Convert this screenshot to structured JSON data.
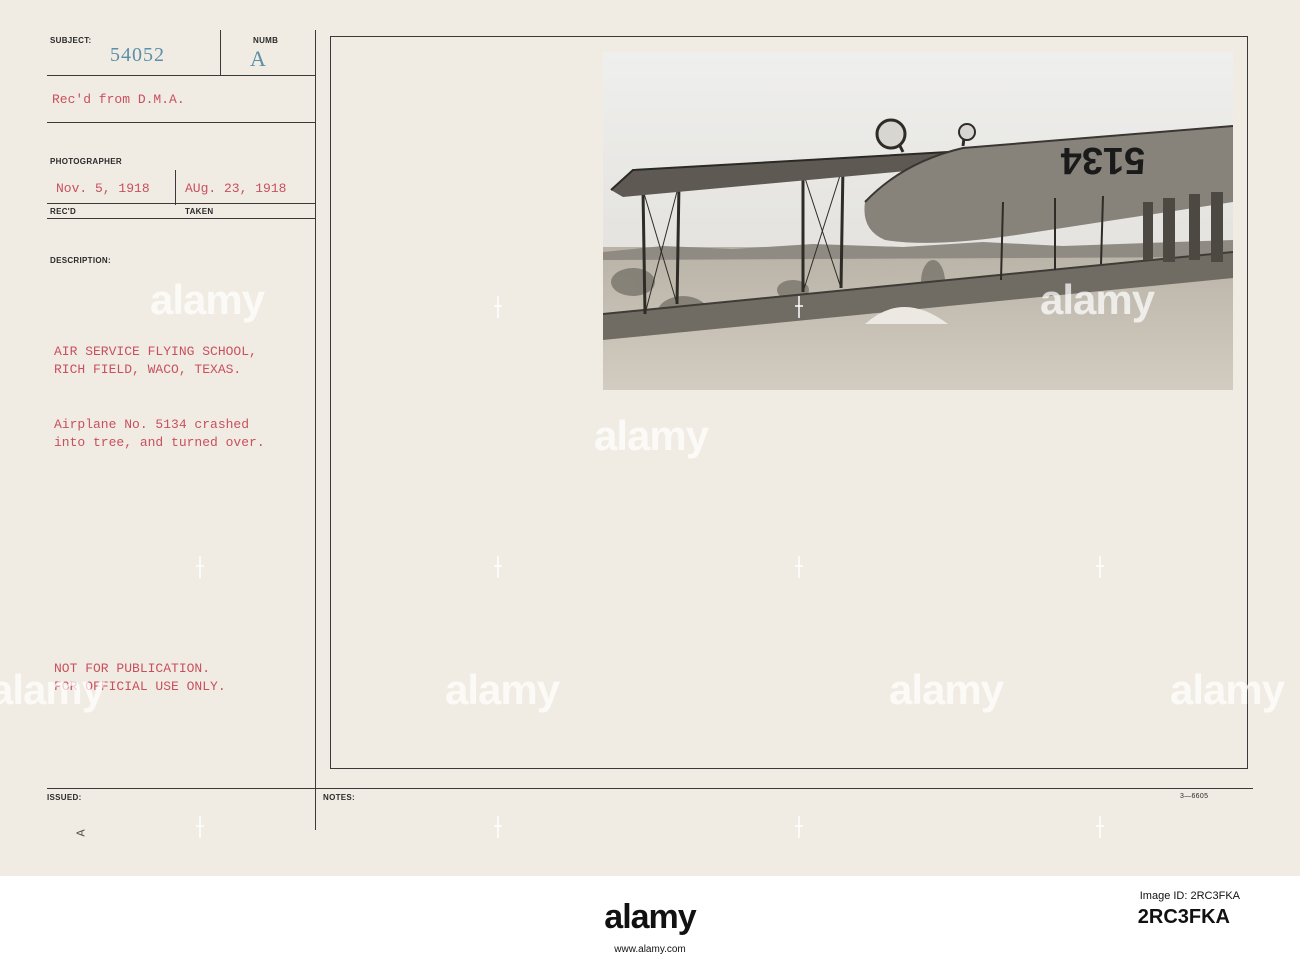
{
  "card": {
    "labels": {
      "subject": "SUBJECT:",
      "number": "NUMB",
      "photographer": "PHOTOGRAPHER",
      "recd": "REC'D",
      "taken": "TAKEN",
      "description": "DESCRIPTION:",
      "issued": "ISSUED:",
      "notes": "NOTES:"
    },
    "subject_number": "54052",
    "number_mark": "A",
    "received_from": "Rec'd from D.M.A.",
    "date_received": "Nov. 5, 1918",
    "date_taken": "AUg. 23, 1918",
    "location_line1": "AIR SERVICE FLYING SCHOOL,",
    "location_line2": "RICH FIELD, WACO, TEXAS.",
    "caption_line1": "Airplane No. 5134 crashed",
    "caption_line2": "into tree, and turned over.",
    "restriction_line1": "NOT FOR PUBLICATION.",
    "restriction_line2": "FOR OFFICIAL USE ONLY.",
    "issued_mark": "A",
    "form_code": "3—6605"
  },
  "photo": {
    "fuselage_number": "5134"
  },
  "watermark": {
    "text": "alamy"
  },
  "footer": {
    "logo": "alamy",
    "image_id_label": "Image ID: 2RC3FKA",
    "site": "www.alamy.com",
    "code": "2RC3FKA"
  },
  "colors": {
    "card": "#f1ece3",
    "typed_red": "#c8505e",
    "stamp_blue": "#5b8fa8",
    "rule": "#3a3a3a"
  }
}
